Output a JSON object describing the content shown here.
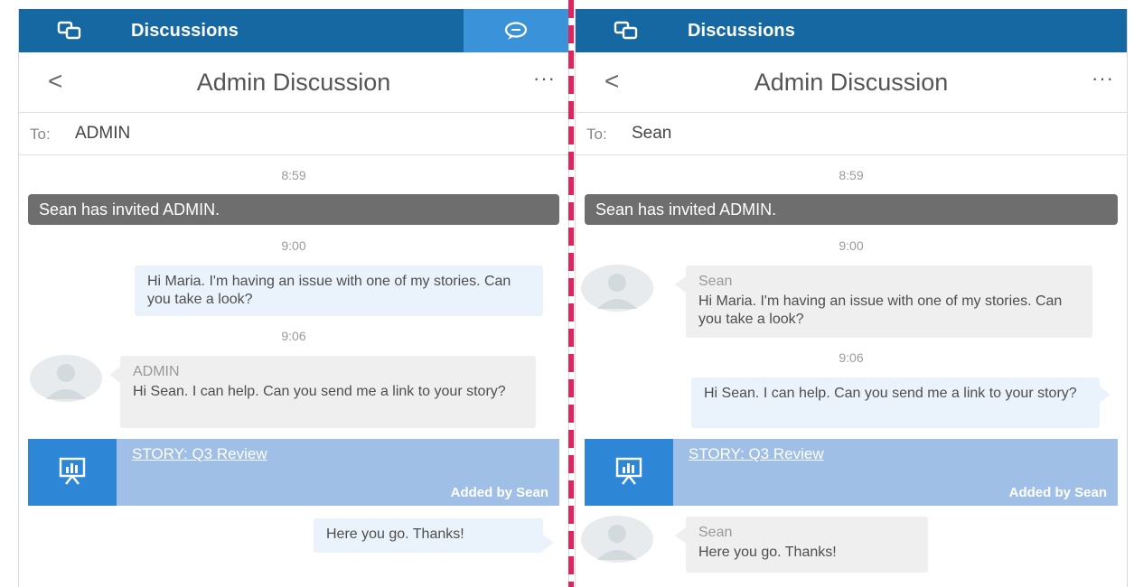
{
  "colors": {
    "topbar": "#1668a3",
    "topbar_active": "#3a92d8",
    "system_message": "#6e6e6e",
    "story_card": "#9fbfe6",
    "story_icon": "#2d87d6",
    "divider": "#e0245e"
  },
  "left": {
    "topbar": {
      "title": "Discussions",
      "icon": "discussions-icon",
      "chat_icon": "chat-bubble-icon"
    },
    "header": {
      "back": "<",
      "title": "Admin Discussion",
      "more": "···"
    },
    "to": {
      "label": "To:",
      "value": "ADMIN"
    },
    "messages": {
      "time1": "8:59",
      "system": "Sean has invited ADMIN.",
      "time2": "9:00",
      "msg1": "Hi Maria. I'm having an issue with one of my stories. Can you take a look?",
      "time3": "9:06",
      "msg2_sender": "ADMIN",
      "msg2": "Hi Sean. I can help. Can you send me a link to your story?",
      "story_title": "STORY: Q3 Review",
      "story_added": "Added by Sean",
      "msg3": "Here you go. Thanks!"
    }
  },
  "right": {
    "topbar": {
      "title": "Discussions",
      "icon": "discussions-icon"
    },
    "header": {
      "back": "<",
      "title": "Admin Discussion",
      "more": "···"
    },
    "to": {
      "label": "To:",
      "value": "Sean"
    },
    "messages": {
      "time1": "8:59",
      "system": "Sean has invited ADMIN.",
      "time2": "9:00",
      "msg1_sender": "Sean",
      "msg1": "Hi Maria. I'm having an issue with one of my stories. Can you take a look?",
      "time3": "9:06",
      "msg2": "Hi Sean. I can help. Can you send me a link to your story?",
      "story_title": "STORY: Q3 Review",
      "story_added": "Added by Sean",
      "msg3_sender": "Sean",
      "msg3": "Here you go. Thanks!"
    }
  }
}
